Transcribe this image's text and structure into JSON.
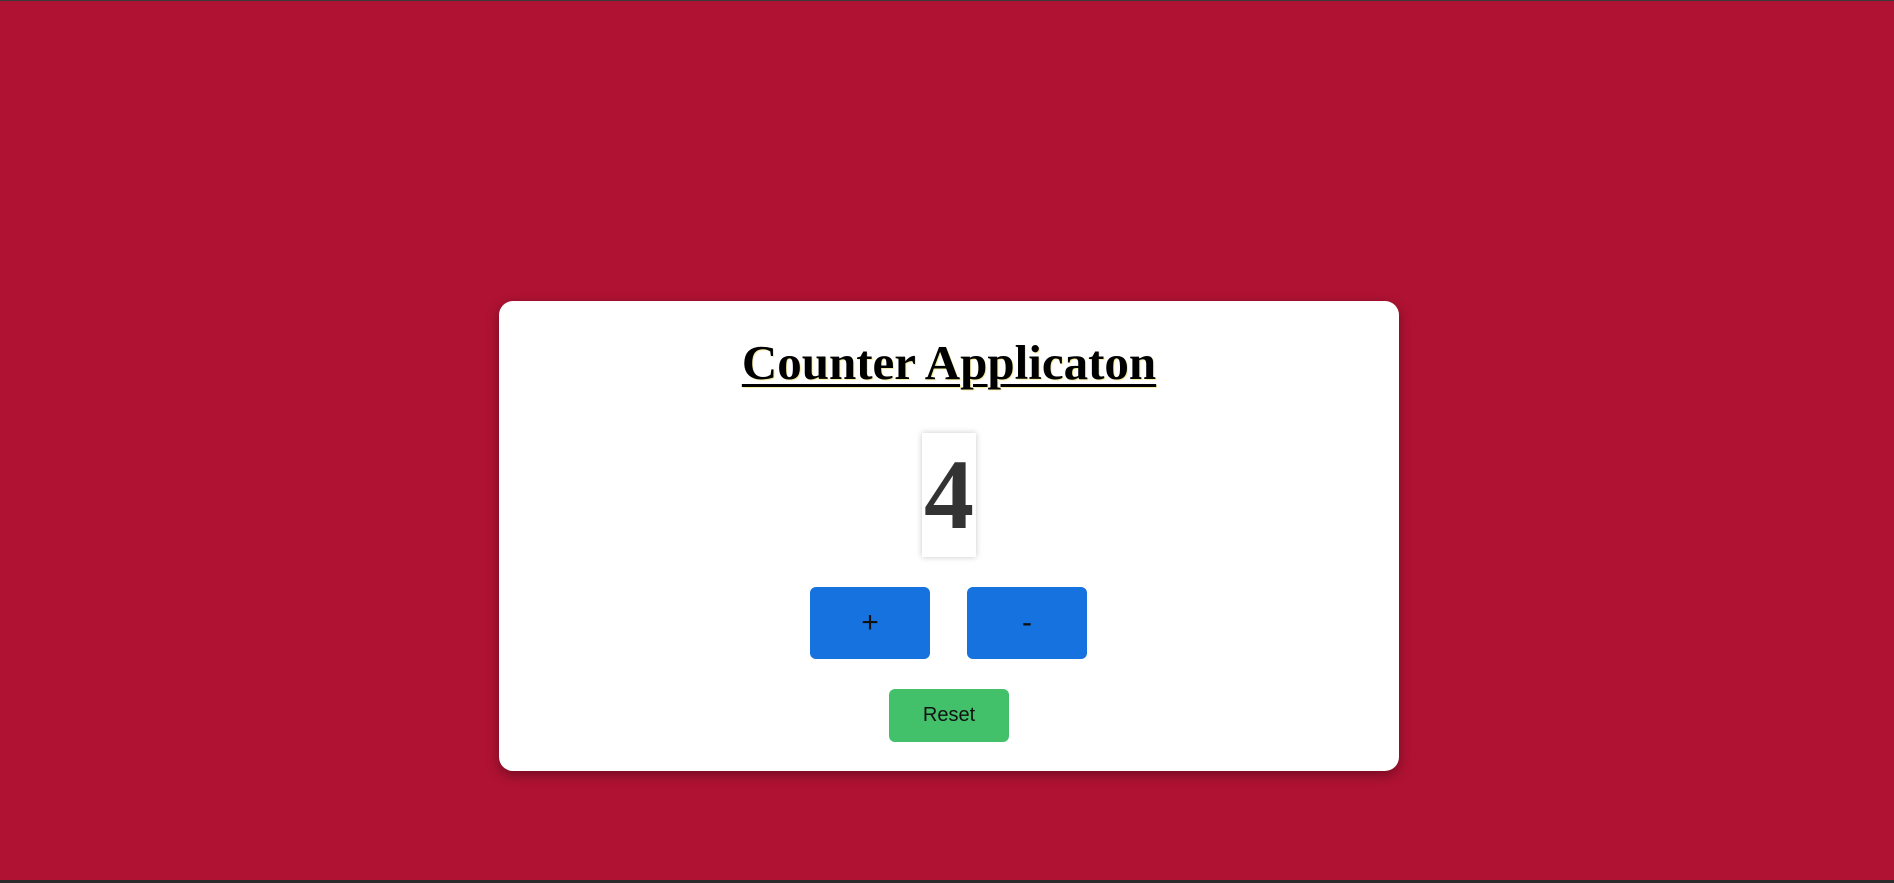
{
  "app": {
    "title": "Counter Applicaton"
  },
  "counter": {
    "value": "4"
  },
  "controls": {
    "increment_label": "+",
    "decrement_label": "-",
    "reset_label": "Reset"
  },
  "colors": {
    "page_background": "#b01233",
    "card_background": "#ffffff",
    "increment_button": "#1572de",
    "decrement_button": "#1572de",
    "reset_button": "#43c06a",
    "counter_text": "#333333"
  }
}
